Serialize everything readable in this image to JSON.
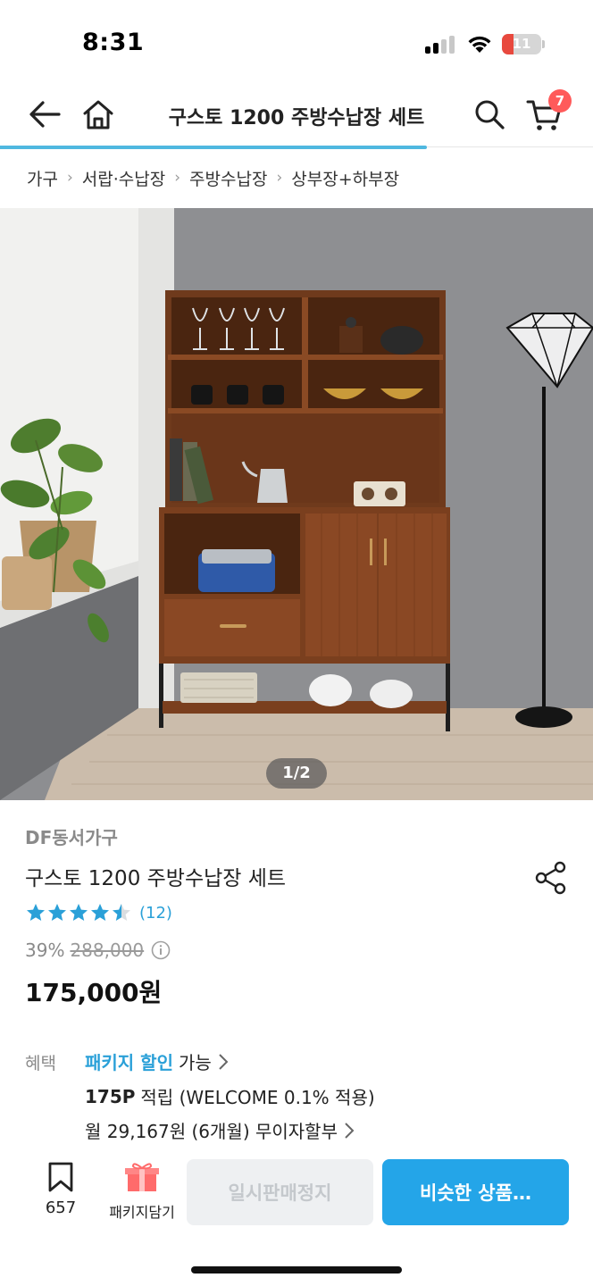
{
  "status_bar": {
    "time": "8:31",
    "battery": "11"
  },
  "header": {
    "title": "구스토 1200 주방수납장 세트",
    "cart_count": "7"
  },
  "breadcrumb": [
    "가구",
    "서랍·수납장",
    "주방수납장",
    "상부장+하부장"
  ],
  "gallery": {
    "counter": "1/2",
    "current": 1,
    "total": 2
  },
  "product": {
    "brand": "DF동서가구",
    "name": "구스토 1200 주방수납장 세트",
    "rating": 4.5,
    "review_count": "(12)",
    "discount": "39%",
    "original_price": "288,000",
    "final_price": "175,000원"
  },
  "benefits": {
    "label": "혜택",
    "package_link": "패키지 할인",
    "package_suffix": "가능",
    "points_bold": "175P",
    "points_text": "적립 (WELCOME 0.1% 적용)",
    "installment": "월 29,167원 (6개월) 무이자할부"
  },
  "bottom_bar": {
    "bookmark_count": "657",
    "package_label": "패키지담기",
    "soldout_label": "일시판매정지",
    "similar_label": "비슷한 상품…"
  },
  "colors": {
    "accent": "#24a5e8",
    "link": "#2aa0d8",
    "badge": "#ff5a5a",
    "star": "#2aa0d8"
  }
}
